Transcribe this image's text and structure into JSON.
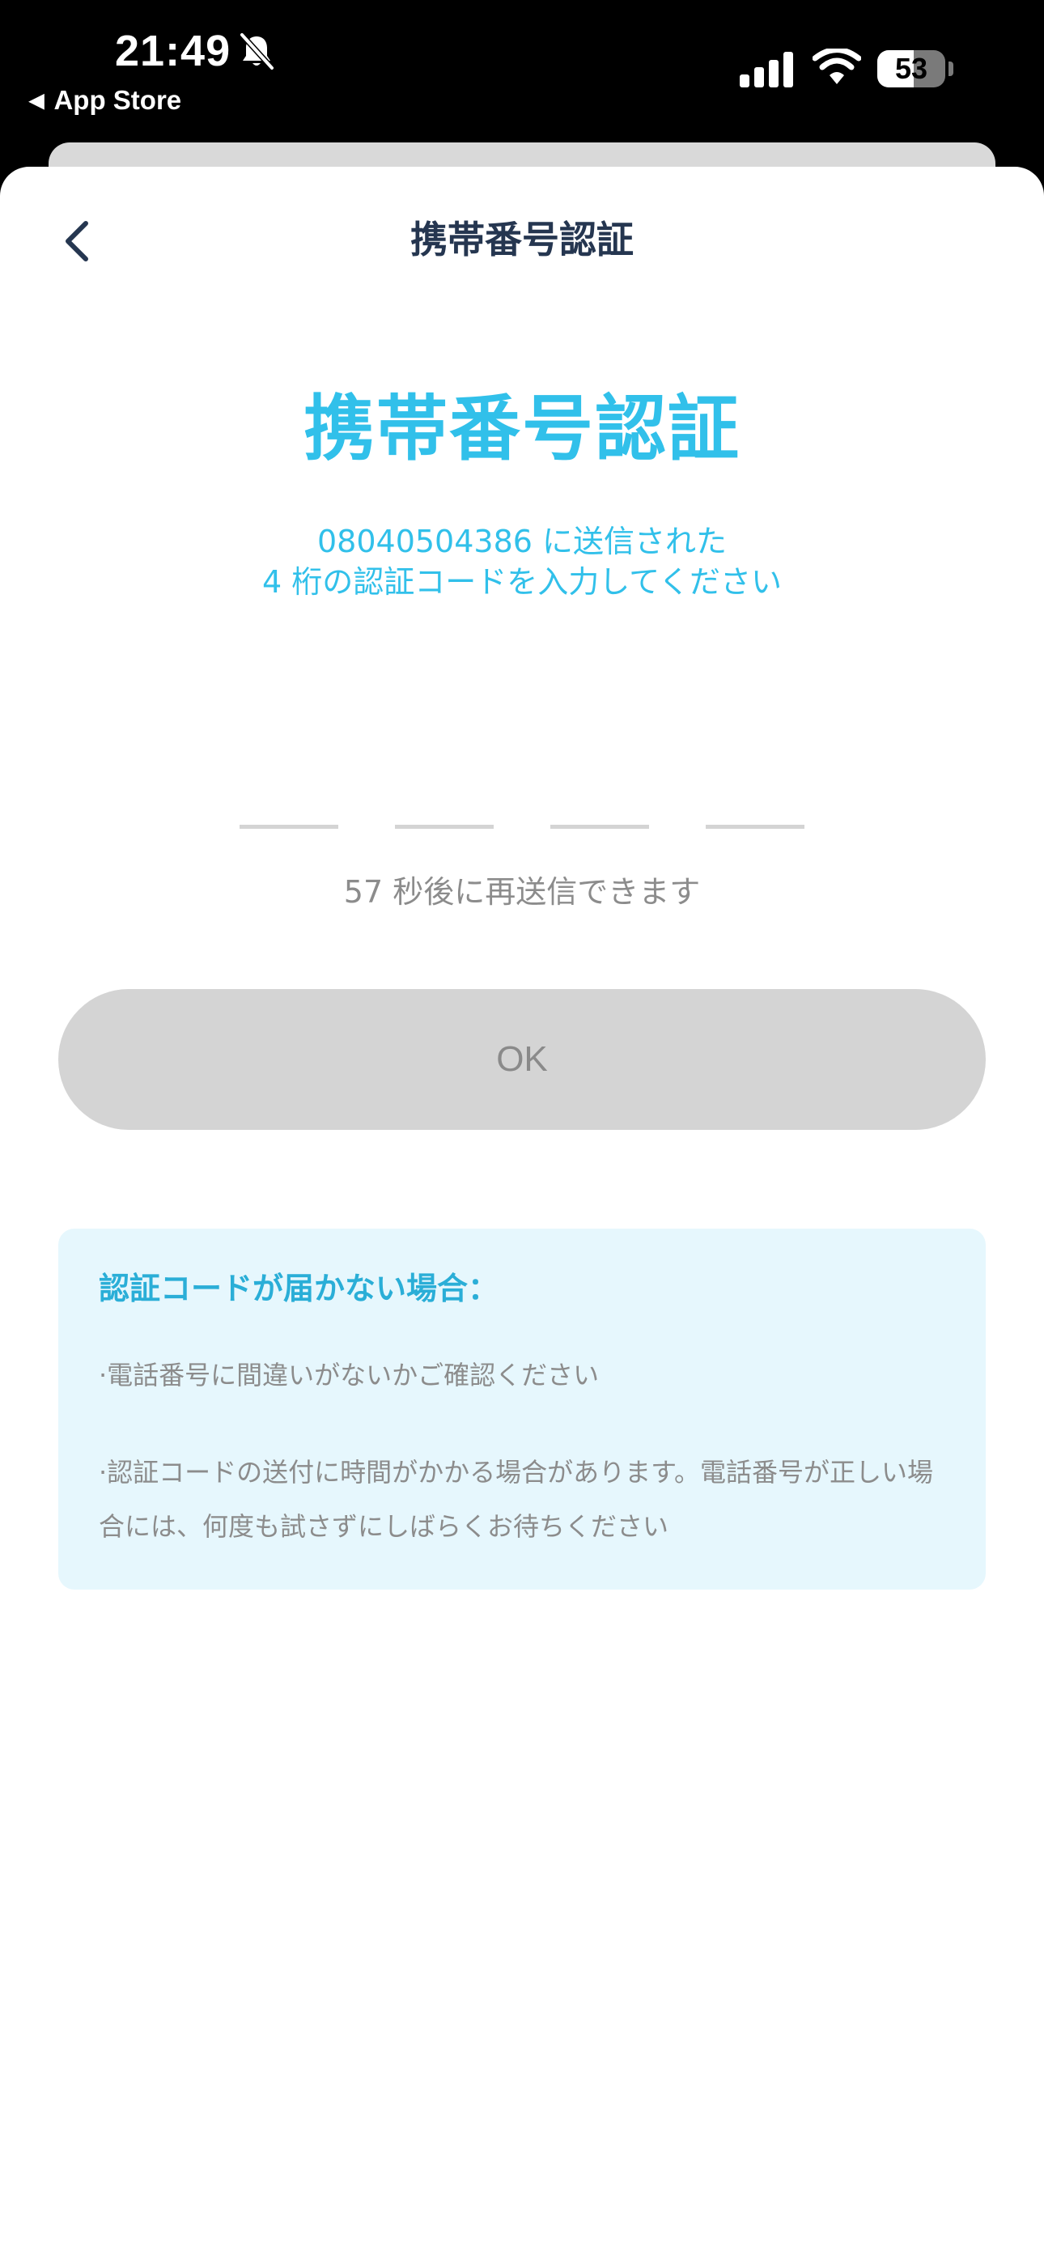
{
  "status_bar": {
    "time": "21:49",
    "back_app": "App Store",
    "battery": "53",
    "battery_level": 0.53
  },
  "nav": {
    "title": "携帯番号認証"
  },
  "main": {
    "title": "携帯番号認証",
    "subtitle_line1": "08040504386 に送信された",
    "subtitle_line2": "4 桁の認証コードを入力してください",
    "code_digits": [
      "",
      "",
      "",
      ""
    ],
    "resend_text": "57 秒後に再送信できます",
    "ok_label": "OK"
  },
  "help": {
    "title": "認証コードが届かない場合：",
    "items": [
      "·電話番号に間違いがないかご確認ください",
      "·認証コードの送付に時間がかかる場合があります。電話番号が正しい場合には、何度も試さずにしばらくお待ちください"
    ]
  },
  "colors": {
    "accent": "#31c0ea",
    "nav_text": "#253650",
    "disabled_button": "#d4d4d4",
    "help_background": "#e6f7fd"
  }
}
